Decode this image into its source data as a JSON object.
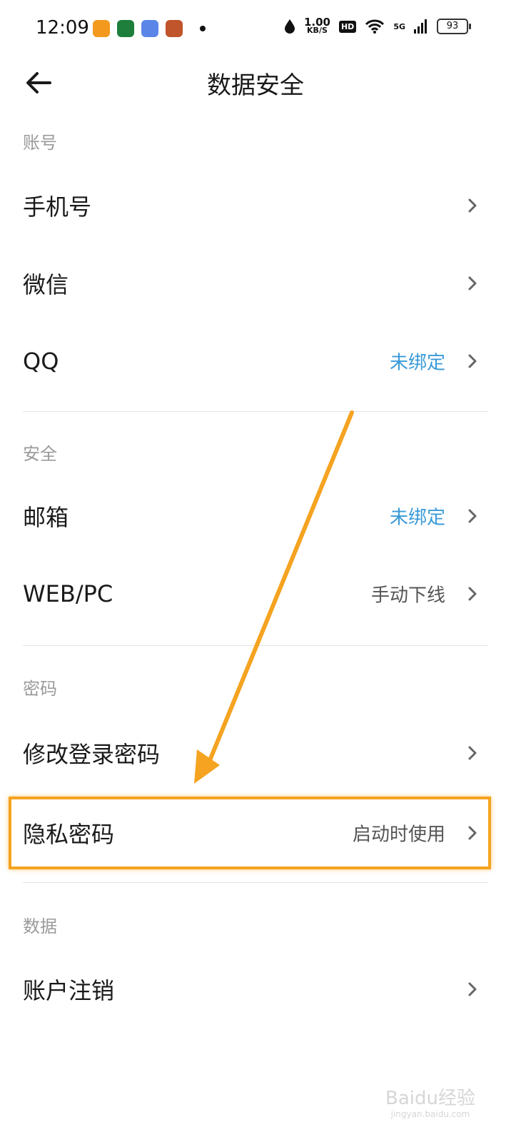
{
  "status_bar": {
    "time": "12:09",
    "speed_value": "1.00",
    "speed_unit": "KB/S",
    "hd": "HD",
    "network": "5G",
    "battery": "93"
  },
  "header": {
    "title": "数据安全"
  },
  "sections": [
    {
      "title": "账号",
      "items": [
        {
          "label": "手机号",
          "value": ""
        },
        {
          "label": "微信",
          "value": ""
        },
        {
          "label": "QQ",
          "value": "未绑定"
        }
      ]
    },
    {
      "title": "安全",
      "items": [
        {
          "label": "邮箱",
          "value": "未绑定"
        },
        {
          "label": "WEB/PC",
          "value": "手动下线"
        }
      ]
    },
    {
      "title": "密码",
      "items": [
        {
          "label": "修改登录密码",
          "value": ""
        },
        {
          "label": "隐私密码",
          "value": "启动时使用"
        }
      ]
    },
    {
      "title": "数据",
      "items": [
        {
          "label": "账户注销",
          "value": ""
        }
      ]
    }
  ],
  "colors": {
    "link": "#3a9ad9",
    "highlight": "#f5a320"
  },
  "watermark": {
    "brand": "Baidu经验",
    "url": "jingyan.baidu.com"
  }
}
